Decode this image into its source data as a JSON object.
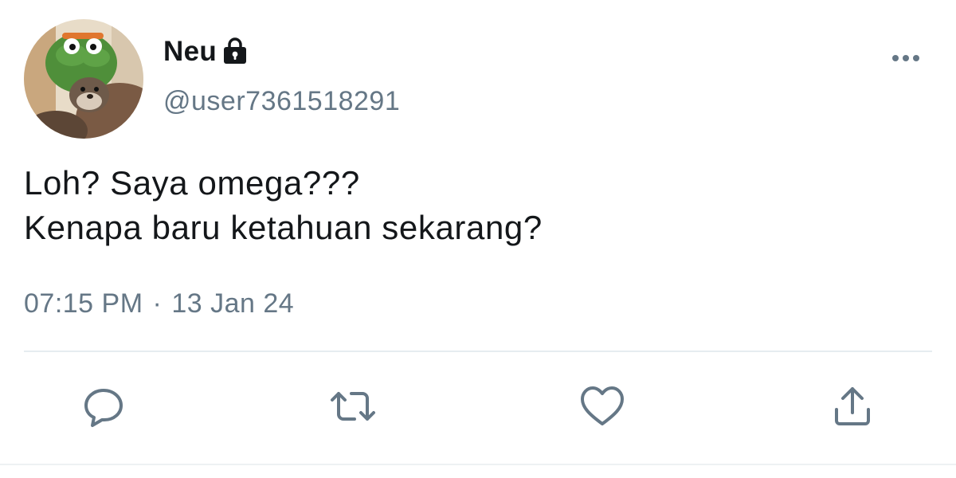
{
  "user": {
    "display_name": "Neu",
    "handle": "@user7361518291",
    "protected": true
  },
  "tweet": {
    "lines": [
      "Loh? Saya omega???",
      "Kenapa baru ketahuan sekarang?"
    ],
    "time": "07:15 PM",
    "separator": "·",
    "date": "13 Jan 24"
  },
  "icons": {
    "avatar": "avatar-otter-photo",
    "protected": "lock-icon",
    "more": "more-options-icon",
    "reply": "reply-icon",
    "retweet": "retweet-icon",
    "like": "like-icon",
    "share": "share-icon"
  },
  "colors": {
    "text_primary": "#14171a",
    "text_secondary": "#657786",
    "icon": "#657786",
    "divider": "#e6ecf0"
  }
}
